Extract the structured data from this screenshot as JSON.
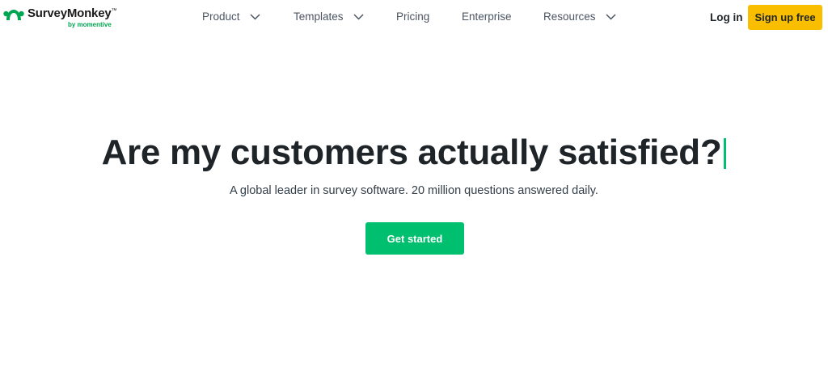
{
  "brand": {
    "name": "SurveyMonkey",
    "trademark": "™",
    "tagline": "by momentive",
    "green": "#00a651",
    "logo_icon": "surveymonkey-logo-icon"
  },
  "nav": {
    "items": [
      {
        "label": "Product",
        "has_dropdown": true
      },
      {
        "label": "Templates",
        "has_dropdown": true
      },
      {
        "label": "Pricing",
        "has_dropdown": false
      },
      {
        "label": "Enterprise",
        "has_dropdown": false
      },
      {
        "label": "Resources",
        "has_dropdown": true
      }
    ],
    "dropdown_icon": "chevron-down-icon"
  },
  "header": {
    "login_label": "Log in",
    "signup_label": "Sign up free",
    "signup_color": "#f9be00"
  },
  "hero": {
    "title": "Are my customers actually satisfied?",
    "subtitle": "A global leader in survey software. 20 million questions answered daily.",
    "cta_label": "Get started",
    "cta_color": "#00bf6f",
    "caret_color": "#00bf6f"
  }
}
